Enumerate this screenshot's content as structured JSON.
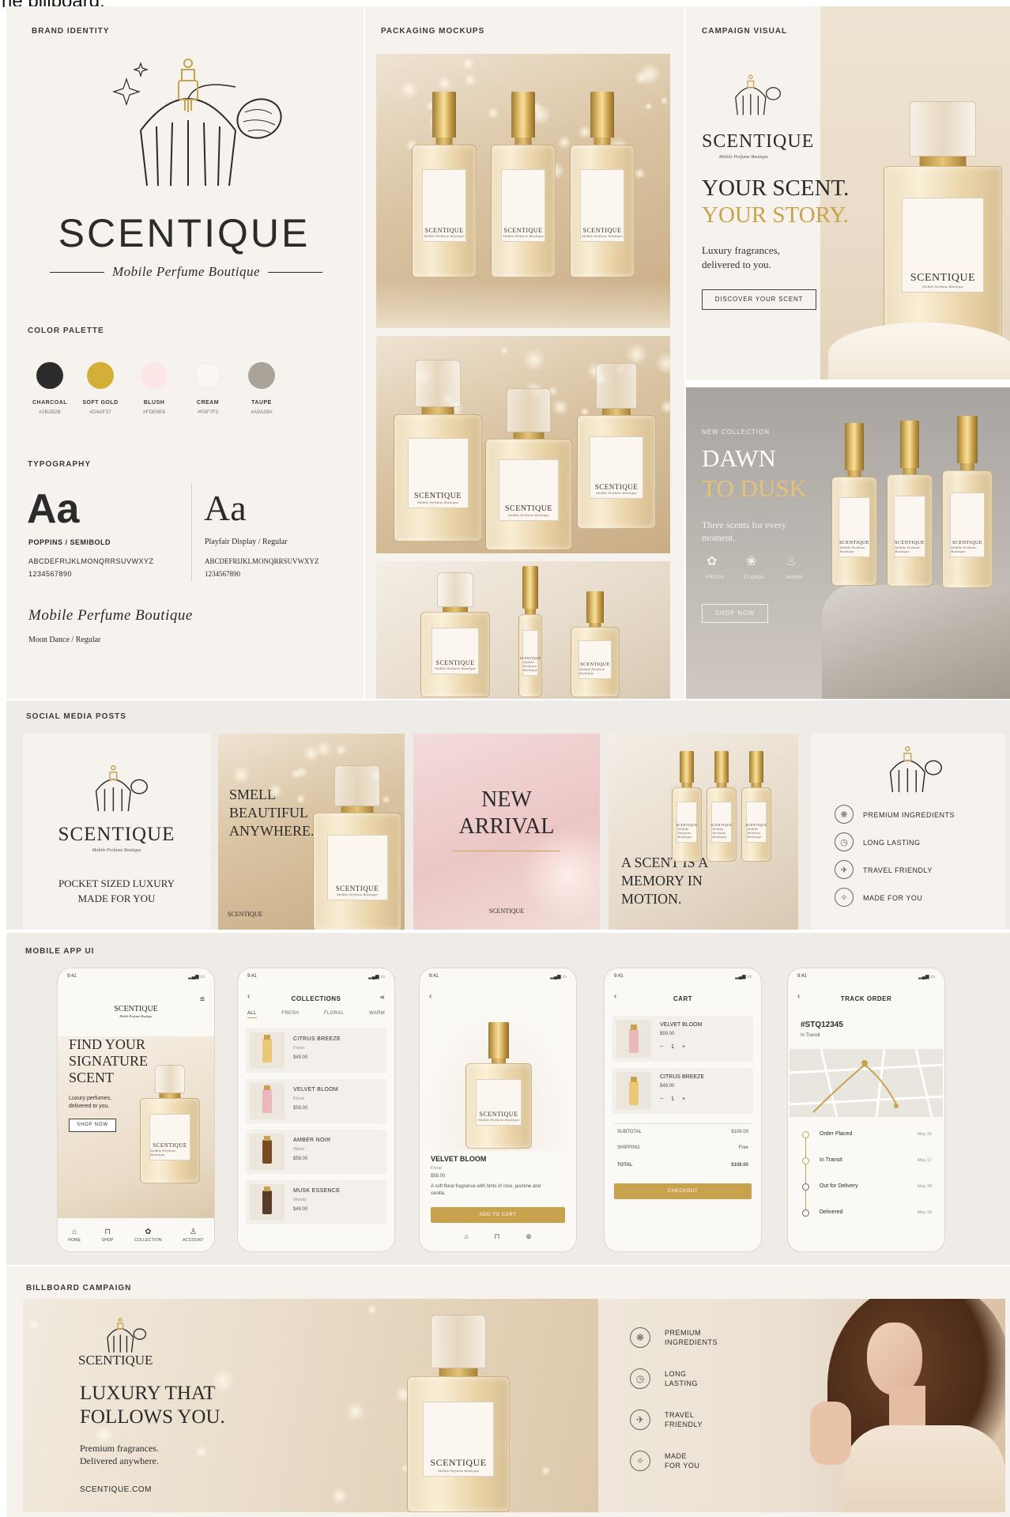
{
  "header_fragment": "he billboard.",
  "brand_identity": {
    "section_label": "BRAND IDENTITY",
    "logo_name": "SCENTIQUE",
    "logo_tagline": "Mobile Perfume Boutique",
    "color_palette_label": "COLOR PALETTE",
    "colors": [
      {
        "name": "CHARCOAL",
        "hex": "#2B2B2B",
        "color": "#2B2B2B"
      },
      {
        "name": "SOFT GOLD",
        "hex": "#D4AF37",
        "color": "#D4AF37"
      },
      {
        "name": "BLUSH",
        "hex": "#FDE6E6",
        "color": "#FDE6E6"
      },
      {
        "name": "CREAM",
        "hex": "#FAF7F2",
        "color": "#FAF7F2"
      },
      {
        "name": "TAUPE",
        "hex": "#A9A39A",
        "color": "#A9A39A"
      }
    ],
    "typography_label": "TYPOGRAPHY",
    "font_sample": "Aa",
    "font1_name": "POPPINS / SEMIBOLD",
    "font2_name": "Playfair Display / Regular",
    "alphabet": "ABCDEFRIJKLMONQRRSUVWXYZ",
    "alphabet_serif": "ABCDEFRIJKLMONQRRSUVWXYZ",
    "digits": "1234567890",
    "script_sample": "Mobile Perfume Boutique",
    "script_font_name": "Moon Dance / Regular"
  },
  "packaging": {
    "section_label": "PACKAGING MOCKUPS",
    "label_name": "SCENTIQUE",
    "label_tag": "Mobile Perfume Boutique"
  },
  "campaign": {
    "section_label": "CAMPAIGN VISUAL",
    "brand": "SCENTIQUE",
    "tagline": "Mobile Perfume Boutique",
    "headline_1": "YOUR SCENT.",
    "headline_2": "YOUR STORY.",
    "body": "Luxury fragrances, delivered to you.",
    "cta": "DISCOVER YOUR SCENT",
    "collection_eyebrow": "NEW COLLECTION",
    "collection_title_1": "DAWN",
    "collection_title_2": "TO DUSK",
    "collection_body": "Three scents for every moment.",
    "notes": [
      "FRESH",
      "FLORAL",
      "WARM"
    ],
    "collection_cta": "SHOP NOW"
  },
  "social": {
    "section_label": "SOCIAL MEDIA POSTS",
    "post1_brand": "SCENTIQUE",
    "post1_tagline": "Mobile Perfume Boutique",
    "post1_text": "POCKET SIZED LUXURY MADE FOR YOU",
    "post2_text": "SMELL BEAUTIFUL ANYWHERE.",
    "post2_brand": "SCENTIQUE",
    "post3_title_1": "NEW",
    "post3_title_2": "ARRIVAL",
    "post3_brand": "SCENTIQUE",
    "post4_text": "A SCENT IS A MEMORY IN MOTION.",
    "post5_features": [
      "PREMIUM INGREDIENTS",
      "LONG LASTING",
      "TRAVEL FRIENDLY",
      "MADE FOR YOU"
    ]
  },
  "mobile": {
    "section_label": "MOBILE APP UI",
    "time": "9:41",
    "home": {
      "brand": "SCENTIQUE",
      "tagline": "Mobile Perfume Boutique",
      "headline": "FIND YOUR SIGNATURE SCENT",
      "body": "Luxury perfumes, delivered to you.",
      "cta": "SHOP NOW",
      "nav": [
        "HOME",
        "SHOP",
        "COLLECTION",
        "ACCOUNT"
      ]
    },
    "collections": {
      "title": "COLLECTIONS",
      "filters": [
        "ALL",
        "FRESH",
        "FLORAL",
        "WARM"
      ],
      "items": [
        {
          "name": "CITRUS BREEZE",
          "note": "Fresh",
          "price": "$49.00",
          "color": "#E9C877"
        },
        {
          "name": "VELVET BLOOM",
          "note": "Floral",
          "price": "$59.00",
          "color": "#E8B8BC"
        },
        {
          "name": "AMBER NOIR",
          "note": "Warm",
          "price": "$59.00",
          "color": "#7A4A22"
        },
        {
          "name": "MUSK ESSENCE",
          "note": "Woody",
          "price": "$49.00",
          "color": "#5A3C2A"
        }
      ]
    },
    "product": {
      "name": "VELVET BLOOM",
      "note": "Floral",
      "price": "$59.00",
      "description": "A soft floral fragrance with hints of rose, jasmine and vanilla.",
      "cta": "ADD TO CART"
    },
    "cart": {
      "title": "CART",
      "items": [
        {
          "name": "VELVET BLOOM",
          "price": "$59.00",
          "qty": "1",
          "color": "#E8B8BC"
        },
        {
          "name": "CITRUS BREEZE",
          "price": "$49.00",
          "qty": "1",
          "color": "#E9C877"
        }
      ],
      "subtotal_label": "SUBTOTAL",
      "subtotal": "$108.00",
      "shipping_label": "SHIPPING",
      "shipping": "Free",
      "total_label": "TOTAL",
      "total": "$108.00",
      "cta": "CHECKOUT"
    },
    "track": {
      "title": "TRACK ORDER",
      "order_id": "#STQ12345",
      "status": "In Transit",
      "steps": [
        {
          "label": "Order Placed",
          "date": "May 16"
        },
        {
          "label": "In Transit",
          "date": "May 17"
        },
        {
          "label": "Out for Delivery",
          "date": "May 18"
        },
        {
          "label": "Delivered",
          "date": "May 19"
        }
      ]
    }
  },
  "billboard": {
    "section_label": "BILLBOARD CAMPAIGN",
    "brand": "SCENTIQUE",
    "headline_1": "LUXURY THAT",
    "headline_2": "FOLLOWS YOU.",
    "body_1": "Premium fragrances.",
    "body_2": "Delivered anywhere.",
    "url": "SCENTIQUE.COM",
    "features": [
      {
        "line1": "PREMIUM",
        "line2": "INGREDIENTS"
      },
      {
        "line1": "LONG",
        "line2": "LASTING"
      },
      {
        "line1": "TRAVEL",
        "line2": "FRIENDLY"
      },
      {
        "line1": "MADE",
        "line2": "FOR YOU"
      }
    ]
  }
}
